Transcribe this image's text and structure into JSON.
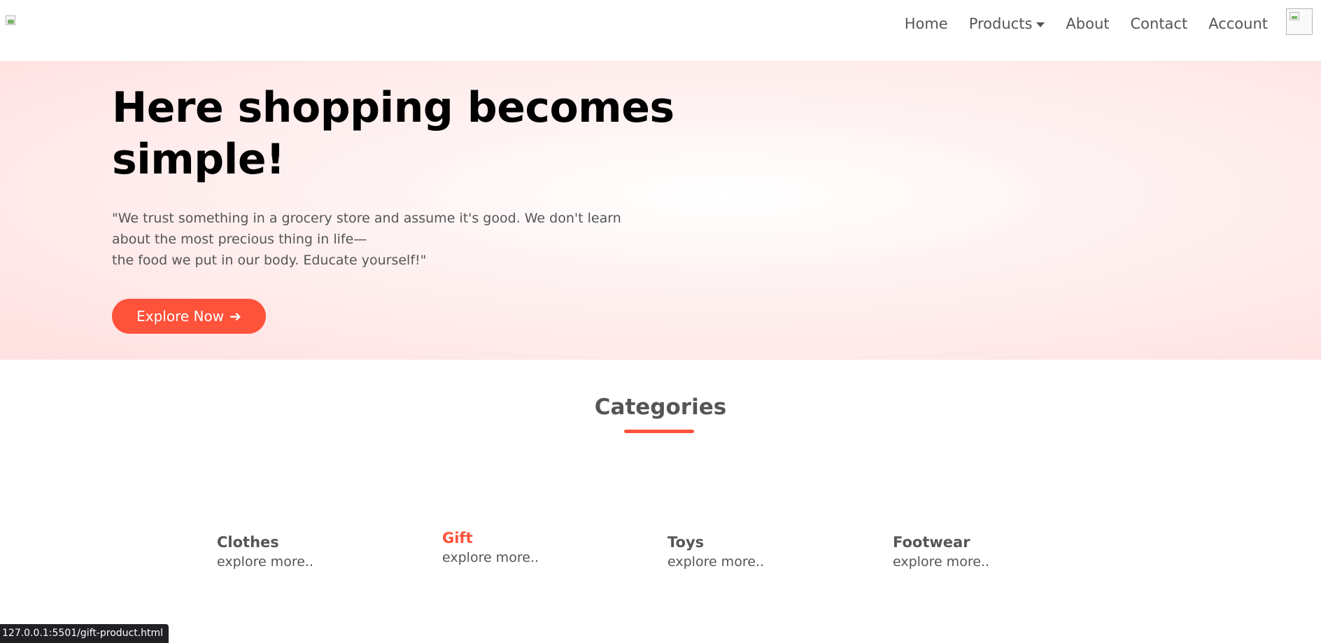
{
  "nav": {
    "items": [
      {
        "label": "Home"
      },
      {
        "label": "Products"
      },
      {
        "label": "About"
      },
      {
        "label": "Contact"
      },
      {
        "label": "Account"
      }
    ]
  },
  "hero": {
    "title_line1": "Here shopping becomes",
    "title_line2": "simple!",
    "quote_line1": "\"We trust something in a grocery store and assume it's good. We don't learn",
    "quote_line2": "about the most precious thing in life—",
    "quote_line3": "the food we put in our body. Educate yourself!\"",
    "button_label": "Explore Now",
    "button_arrow": "➔"
  },
  "categories": {
    "title": "Categories",
    "accent_color": "#ff523b",
    "items": [
      {
        "name": "Clothes",
        "sub": "explore more.."
      },
      {
        "name": "Gift",
        "sub": "explore more.."
      },
      {
        "name": "Toys",
        "sub": "explore more.."
      },
      {
        "name": "Footwear",
        "sub": "explore more.."
      }
    ]
  },
  "status_bar": {
    "url": "127.0.0.1:5501/gift-product.html"
  }
}
